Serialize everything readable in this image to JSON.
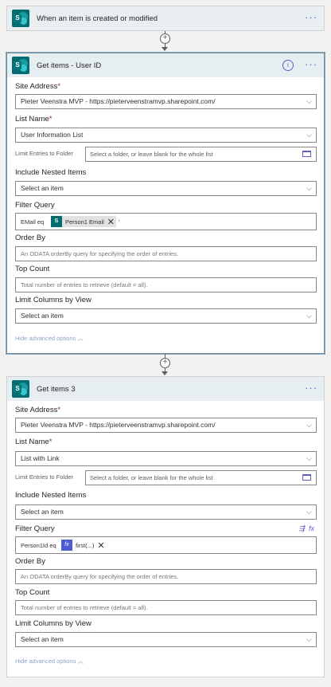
{
  "trigger": {
    "title": "When an item is created or modified",
    "more": "···"
  },
  "card1": {
    "title": "Get items - User ID",
    "info": "i",
    "more": "···",
    "site_address_label": "Site Address",
    "site_address_value": "Pieter Veenstra MVP - https://pieterveenstramvp.sharepoint.com/",
    "list_name_label": "List Name",
    "list_name_value": "User Information List",
    "limit_folder_label": "Limit Entries to Folder",
    "limit_folder_placeholder": "Select a folder, or leave blank for the whole list",
    "nested_label": "Include Nested Items",
    "nested_value": "Select an item",
    "filter_label": "Filter Query",
    "filter_prefix": "EMail eq",
    "filter_token": "Person1 Email",
    "filter_suffix": "'",
    "order_label": "Order By",
    "order_placeholder": "An ODATA orderBy query for specifying the order of entries.",
    "top_label": "Top Count",
    "top_placeholder": "Total number of entries to retrieve (default = all).",
    "limit_cols_label": "Limit Columns by View",
    "limit_cols_value": "Select an item",
    "hide_advanced": "Hide advanced options"
  },
  "card2": {
    "title": "Get items 3",
    "more": "···",
    "site_address_label": "Site Address",
    "site_address_value": "Pieter Veenstra MVP - https://pieterveenstramvp.sharepoint.com/",
    "list_name_label": "List Name",
    "list_name_value": "List with Link",
    "limit_folder_label": "Limit Entries to Folder",
    "limit_folder_placeholder": "Select a folder, or leave blank for the whole list",
    "nested_label": "Include Nested Items",
    "nested_value": "Select an item",
    "filter_label": "Filter Query",
    "filter_prefix": "Person1Id eq",
    "filter_token": "first(...)",
    "order_label": "Order By",
    "order_placeholder": "An ODATA orderBy query for specifying the order of entries.",
    "top_label": "Top Count",
    "top_placeholder": "Total number of entries to retrieve (default = all).",
    "limit_cols_label": "Limit Columns by View",
    "limit_cols_value": "Select an item",
    "hide_advanced": "Hide advanced options"
  },
  "required_mark": "*",
  "icons": {
    "chevron": "⌵",
    "close": "✕",
    "add": "+",
    "hide_chevron": "︿"
  },
  "colors": {
    "sharepoint": "#036c70",
    "accent": "#5b5fc7",
    "required": "#a4262c"
  }
}
